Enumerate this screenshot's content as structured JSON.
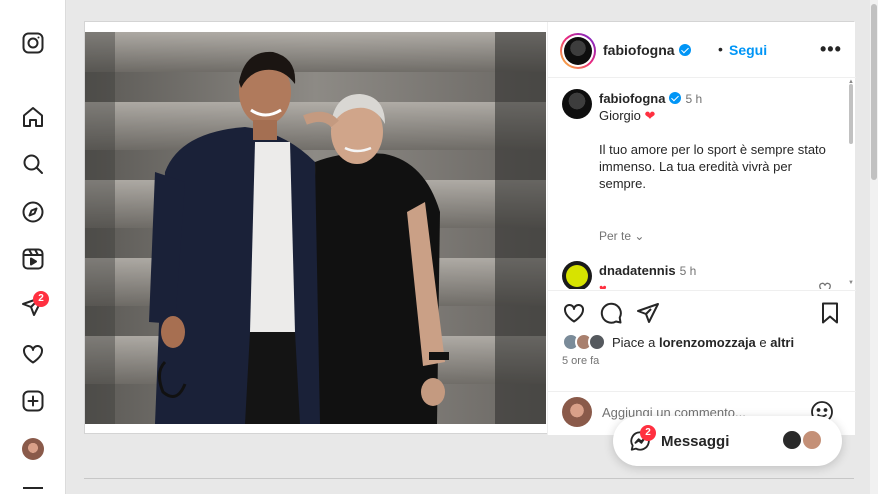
{
  "sidebar": {
    "items": [
      {
        "name": "instagram-logo-icon",
        "badge": ""
      },
      {
        "name": "home-icon",
        "badge": ""
      },
      {
        "name": "search-icon",
        "badge": ""
      },
      {
        "name": "explore-icon",
        "badge": ""
      },
      {
        "name": "reels-icon",
        "badge": ""
      },
      {
        "name": "direct-icon",
        "badge": "2"
      },
      {
        "name": "heart-icon",
        "badge": ""
      },
      {
        "name": "create-icon",
        "badge": ""
      },
      {
        "name": "profile-avatar",
        "badge": ""
      }
    ]
  },
  "post": {
    "author": "fabiofogna",
    "dot": "•",
    "follow_label": "Segui",
    "more_label": "•••",
    "caption": {
      "user": "fabiofogna",
      "time": "5 h",
      "line1": "Giorgio",
      "line2": "Il tuo amore per lo sport è sempre stato immenso. La tua eredità vivrà per sempre.",
      "translate_label": "Per te"
    },
    "comments": [
      {
        "user": "dnadatennis",
        "time": "5 h",
        "text": "♥"
      }
    ],
    "likes": {
      "prefix": "Piace a ",
      "user": "lorenzomozzaja",
      "middle": " e ",
      "others": "altri"
    },
    "time_ago": "5 ore fa",
    "add_comment_placeholder": "Aggiungi un commento..."
  },
  "messages": {
    "label": "Messaggi",
    "badge": "2"
  },
  "colors": {
    "accent": "#0095f6",
    "badge": "#ff3040",
    "heart": "#ff3040"
  }
}
